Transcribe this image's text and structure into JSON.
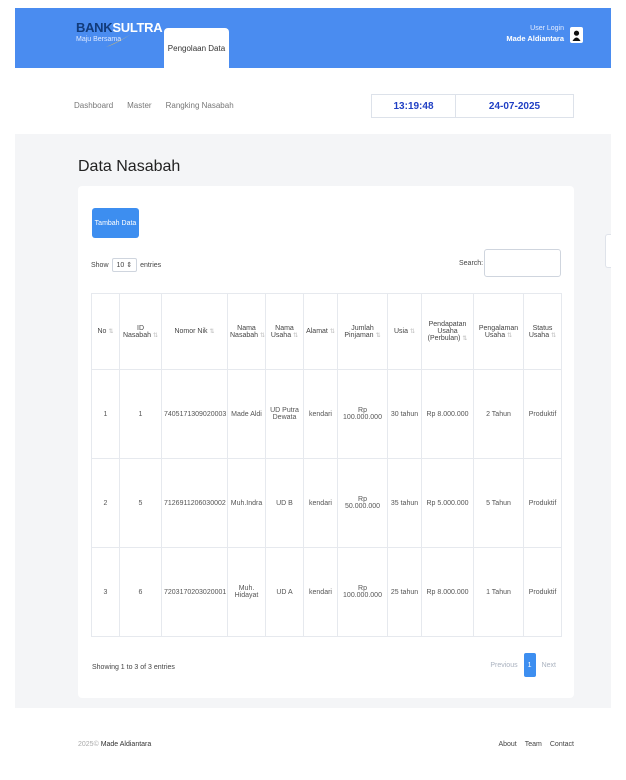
{
  "header": {
    "brand_prefix": "BANK",
    "brand_suffix": "SULTRA",
    "tagline": "Maju Bersama",
    "nav_tab": "Pengolaan Data",
    "user_login_label": "User Login",
    "user_name": "Made Aldiantara",
    "brand_color": "#4a8cf0"
  },
  "subnav": {
    "breadcrumbs": [
      "Dashboard",
      "Master",
      "Rangking Nasabah"
    ],
    "time": "13:19:48",
    "date": "24-07-2025"
  },
  "page_title": "Data Nasabah",
  "controls": {
    "add_button": "Tambah Data",
    "show_label": "Show",
    "entries_value": "10",
    "entries_label": "entries",
    "search_label": "Search:"
  },
  "table": {
    "headers": [
      "No",
      "ID Nasabah",
      "Nomor Nik",
      "Nama Nasabah",
      "Nama Usaha",
      "Alamat",
      "Jumlah Pinjaman",
      "Usia",
      "Pendapatan Usaha (Perbulan)",
      "Pengalaman Usaha",
      "Status Usaha"
    ],
    "rows": [
      [
        "1",
        "1",
        "7405171309020003",
        "Made Aldi",
        "UD Putra Dewata",
        "kendari",
        "Rp 100.000.000",
        "30 tahun",
        "Rp 8.000.000",
        "2 Tahun",
        "Produktif"
      ],
      [
        "2",
        "5",
        "7126911206030002",
        "Muh.Indra",
        "UD B",
        "kendari",
        "Rp 50.000.000",
        "35 tahun",
        "Rp 5.000.000",
        "5 Tahun",
        "Produktif"
      ],
      [
        "3",
        "6",
        "7203170203020001",
        "Muh. Hidayat",
        "UD A",
        "kendari",
        "Rp 100.000.000",
        "25 tahun",
        "Rp 8.000.000",
        "1 Tahun",
        "Produktif"
      ]
    ]
  },
  "footer_table": {
    "info": "Showing 1 to 3 of 3 entries",
    "previous": "Previous",
    "page": "1",
    "next": "Next"
  },
  "footer": {
    "year": "2025©",
    "author": "Made Aldiantara",
    "links": [
      "About",
      "Team",
      "Contact"
    ]
  }
}
